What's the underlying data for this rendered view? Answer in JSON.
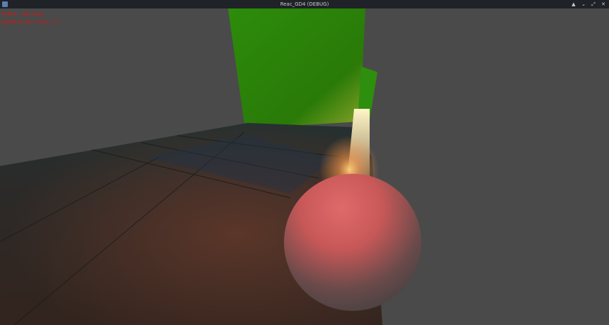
{
  "window": {
    "title": "Reac_GD4 (DEBUG)",
    "app_icon": "godot-icon",
    "controls": [
      {
        "name": "keep-above-icon",
        "glyph": "▲"
      },
      {
        "name": "minimize-icon",
        "glyph": "⌄"
      },
      {
        "name": "maximize-icon",
        "glyph": "⤢"
      },
      {
        "name": "close-icon",
        "glyph": "✕"
      }
    ]
  },
  "hud": {
    "line1": "State: Rolling",
    "line2": "Speed:0.00 Coins: 0"
  },
  "scene": {
    "background_color": "#4a4a4a",
    "wall_color": "#2a8a0a",
    "floor_color": "#2a2a26",
    "ball_color": "#d86060",
    "light_color": "#ff9a4a"
  }
}
